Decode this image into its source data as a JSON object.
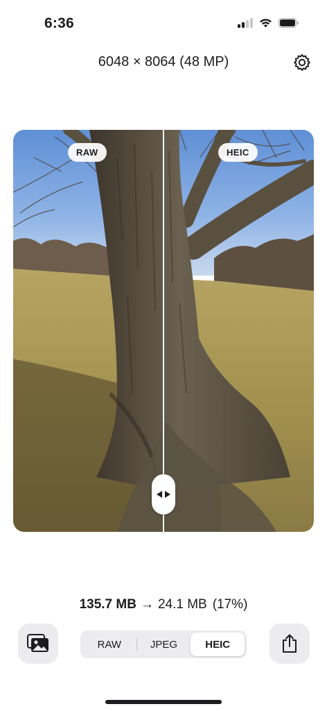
{
  "status_bar": {
    "time": "6:36",
    "icons": [
      "cellular-signal-icon",
      "wifi-icon",
      "battery-icon"
    ]
  },
  "header": {
    "resolution": "6048 × 8064 (48 MP)",
    "settings_icon": "gear-icon"
  },
  "comparison": {
    "left_label": "RAW",
    "right_label": "HEIC",
    "handle_icon": "left-right-arrows-icon"
  },
  "size_summary": {
    "original": "135.7 MB",
    "arrow": "→",
    "converted": "24.1 MB",
    "percent": "(17%)"
  },
  "format_control": {
    "options": [
      "RAW",
      "JPEG",
      "HEIC"
    ],
    "selected": "HEIC"
  },
  "bottom_bar": {
    "gallery_icon": "photo-library-icon",
    "share_icon": "share-icon"
  },
  "colors": {
    "sky": "#7fa8e0",
    "grass": "#a99655",
    "bark": "#5a5040",
    "control_bg": "#ececee"
  }
}
